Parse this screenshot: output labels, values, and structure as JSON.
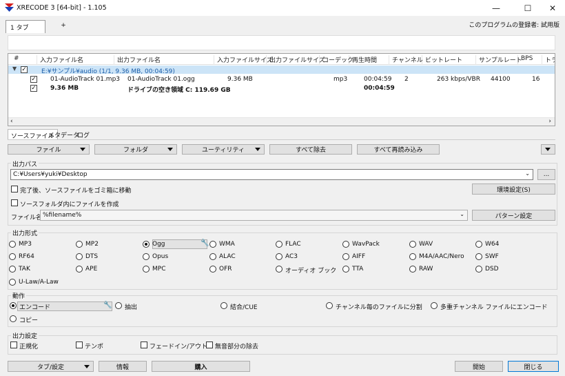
{
  "window": {
    "title": "XRECODE 3 [64-bit] - 1.105",
    "minimize": "—",
    "maximize": "☐",
    "close": "✕"
  },
  "file_tabs": {
    "tab1": "1 タブ",
    "add": "+"
  },
  "registration": "このプログラムの登録者: 試用版",
  "columns": [
    "#",
    "入力ファイル名",
    "出力ファイル名",
    "入力ファイルサイズ",
    "出力ファイルサイズ",
    "コーデック",
    "再生時間",
    "チャンネル",
    "ビットレート",
    "サンプルレート",
    "BPS",
    "トラ"
  ],
  "group_row": {
    "label": "E:¥サンプル¥audio (1/1, 9.36 MB, 00:04:59)"
  },
  "file_row": {
    "input": "01-AudioTrack 01.mp3",
    "output": "01-AudioTrack 01.ogg",
    "input_size": "9.36 MB",
    "codec": "mp3",
    "duration": "00:04:59",
    "channels": "2",
    "bitrate": "263 kbps/VBR",
    "samplerate": "44100",
    "bps": "16"
  },
  "summary_row": {
    "size": "9.36 MB",
    "free_space": "ドライブの空き領域 C: 119.69 GB",
    "duration": "00:04:59"
  },
  "sub_tabs": [
    "ソースファイル",
    "メタデータ",
    "ログ"
  ],
  "toolbar": {
    "file": "ファイル",
    "folder": "フォルダ",
    "utility": "ユーティリティ",
    "remove_all": "すべて除去",
    "reload_all": "すべて再読み込み"
  },
  "output_path": {
    "title": "出力パス",
    "value": "C:¥Users¥yuki¥Desktop",
    "browse": "...",
    "move_trash": "完了後、ソースファイルをゴミ箱に移動",
    "create_in_source": "ソースフォルダ内にファイルを作成",
    "env_settings": "環境設定(S)",
    "filename_label": "ファイル名:",
    "filename_value": "%filename%",
    "pattern": "パターン設定"
  },
  "formats": {
    "title": "出力形式",
    "selected": "Ogg",
    "items": [
      "MP3",
      "MP2",
      "Ogg",
      "WMA",
      "FLAC",
      "WavPack",
      "WAV",
      "W64",
      "RF64",
      "DTS",
      "Opus",
      "ALAC",
      "AC3",
      "AIFF",
      "M4A/AAC/Nero",
      "SWF",
      "TAK",
      "APE",
      "MPC",
      "OFR",
      "オーディオ ブック",
      "TTA",
      "RAW",
      "DSD",
      "U-Law/A-Law"
    ]
  },
  "action": {
    "title": "動作",
    "items": [
      "エンコード",
      "抽出",
      "結合/CUE",
      "チャンネル毎のファイルに分割",
      "多重チャンネル ファイルにエンコード",
      "コピー"
    ]
  },
  "output_settings": {
    "title": "出力設定",
    "items": [
      "正規化",
      "テンポ",
      "フェードイン/アウト",
      "無音部分の除去"
    ]
  },
  "bottom": {
    "tab_settings": "タブ/設定",
    "info": "情報",
    "buy": "購入",
    "start": "開始",
    "close": "閉じる"
  },
  "colors": {
    "accent": "#1c5da8",
    "group_bg": "#cce4f7",
    "icon_red": "#d42020",
    "icon_blue": "#1a3fb5"
  }
}
